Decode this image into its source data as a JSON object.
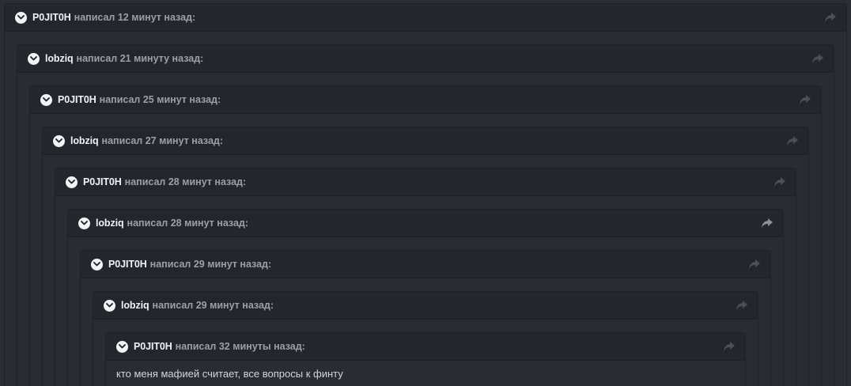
{
  "thread": {
    "posts": [
      {
        "author": "P0JIT0H",
        "time": "написал 12 минут назад:"
      },
      {
        "author": "lobziq",
        "time": "написал 21 минуту назад:"
      },
      {
        "author": "P0JIT0H",
        "time": "написал 25 минут назад:"
      },
      {
        "author": "lobziq",
        "time": "написал 27 минут назад:"
      },
      {
        "author": "P0JIT0H",
        "time": "написал 28 минут назад:"
      },
      {
        "author": "lobziq",
        "time": "написал 28 минут назад:"
      },
      {
        "author": "P0JIT0H",
        "time": "написал 29 минут назад:"
      },
      {
        "author": "lobziq",
        "time": "написал 29 минут назад:"
      },
      {
        "author": "P0JIT0H",
        "time": "написал 32 минуты назад:",
        "body": "кто меня мафией считает, все вопросы к финту"
      }
    ]
  },
  "icons": {
    "toggle": "chevron-down-icon",
    "share": "share-arrow-icon"
  },
  "colors": {
    "background": "#2a2d34",
    "header": "#23262c",
    "author": "#f1f2f4",
    "meta": "#9aa0a9"
  }
}
